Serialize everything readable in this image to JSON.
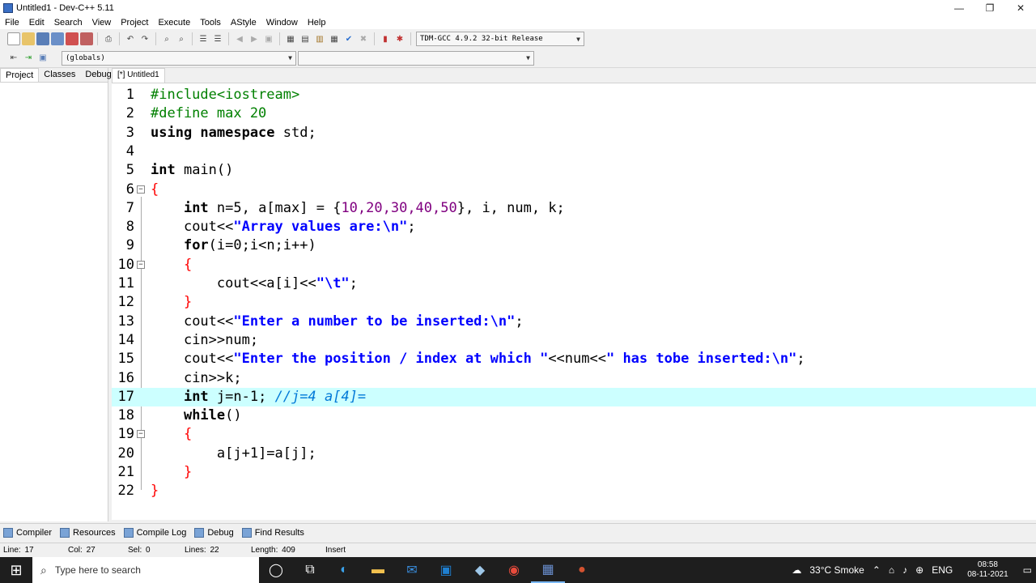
{
  "window": {
    "title": "Untitled1 - Dev-C++ 5.11",
    "min": "—",
    "max": "❐",
    "close": "✕"
  },
  "menu": [
    "File",
    "Edit",
    "Search",
    "View",
    "Project",
    "Execute",
    "Tools",
    "AStyle",
    "Window",
    "Help"
  ],
  "toolbar": {
    "compiler_select": "TDM-GCC 4.9.2 32-bit Release",
    "scope_select": "(globals)",
    "symbol_select": ""
  },
  "left_panel": {
    "tabs": [
      "Project",
      "Classes",
      "Debug"
    ]
  },
  "editor_tabs": [
    "[*] Untitled1"
  ],
  "code_lines": [
    {
      "n": "1",
      "fold": ""
    },
    {
      "n": "2",
      "fold": ""
    },
    {
      "n": "3",
      "fold": ""
    },
    {
      "n": "4",
      "fold": ""
    },
    {
      "n": "5",
      "fold": ""
    },
    {
      "n": "6",
      "fold": "⊟"
    },
    {
      "n": "7",
      "fold": ""
    },
    {
      "n": "8",
      "fold": ""
    },
    {
      "n": "9",
      "fold": ""
    },
    {
      "n": "10",
      "fold": "⊟"
    },
    {
      "n": "11",
      "fold": ""
    },
    {
      "n": "12",
      "fold": ""
    },
    {
      "n": "13",
      "fold": ""
    },
    {
      "n": "14",
      "fold": ""
    },
    {
      "n": "15",
      "fold": ""
    },
    {
      "n": "16",
      "fold": ""
    },
    {
      "n": "17",
      "fold": ""
    },
    {
      "n": "18",
      "fold": ""
    },
    {
      "n": "19",
      "fold": "⊟"
    },
    {
      "n": "20",
      "fold": ""
    },
    {
      "n": "21",
      "fold": ""
    },
    {
      "n": "22",
      "fold": ""
    }
  ],
  "code": {
    "l1": "#include<iostream>",
    "l2": "#define max 20",
    "l3_kw": "using namespace",
    "l3_rest": " std;",
    "l5_kw": "int",
    "l5_rest": " main()",
    "l6": "{",
    "l7_kw": "int",
    "l7_a": " n=5, a[max] = {",
    "l7_nums": "10,20,30,40,50",
    "l7_b": "}, i, num, k;",
    "l8_a": "cout<<",
    "l8_s": "\"Array values are:\\n\"",
    "l8_b": ";",
    "l9_kw": "for",
    "l9_rest": "(i=0;i<n;i++)",
    "l10": "{",
    "l11_a": "cout<<a[i]<<",
    "l11_s": "\"\\t\"",
    "l11_b": ";",
    "l12": "}",
    "l13_a": "cout<<",
    "l13_s": "\"Enter a number to be inserted:\\n\"",
    "l13_b": ";",
    "l14": "cin>>num;",
    "l15_a": "cout<<",
    "l15_s1": "\"Enter the position / index at which \"",
    "l15_m": "<<num<<",
    "l15_s2": "\" has tobe inserted:\\n\"",
    "l15_b": ";",
    "l16": "cin>>k;",
    "l17_kw": "int",
    "l17_rest": " j=n-1; ",
    "l17_c": "//j=4 a[4]=",
    "l18_kw": "while",
    "l18_rest": "()",
    "l19": "{",
    "l20": "a[j+1]=a[j];",
    "l21": "}",
    "l22": "}"
  },
  "bottom_tabs": [
    "Compiler",
    "Resources",
    "Compile Log",
    "Debug",
    "Find Results"
  ],
  "status": {
    "line_label": "Line:",
    "line": "17",
    "col_label": "Col:",
    "col": "27",
    "sel_label": "Sel:",
    "sel": "0",
    "lines_label": "Lines:",
    "lines": "22",
    "length_label": "Length:",
    "length": "409",
    "mode": "Insert"
  },
  "taskbar": {
    "search_placeholder": "Type here to search",
    "weather": "33°C Smoke",
    "lang": "ENG",
    "time": "08:58",
    "date": "08-11-2021"
  }
}
